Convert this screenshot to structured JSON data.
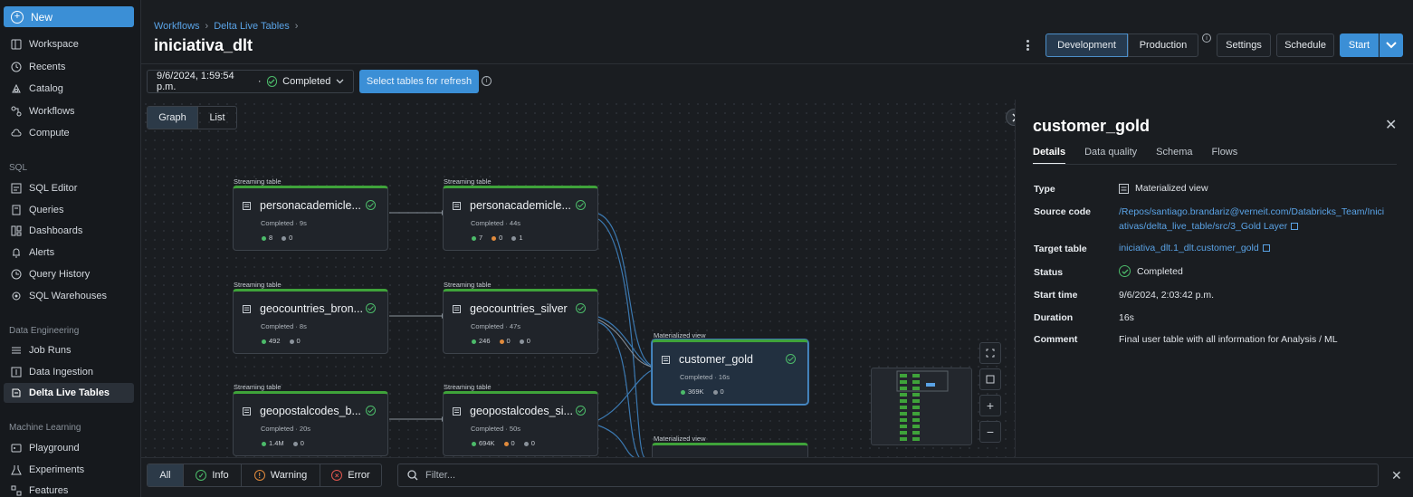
{
  "sidebar": {
    "new_label": "New",
    "items": [
      {
        "label": "Workspace",
        "icon": "workspace-icon"
      },
      {
        "label": "Recents",
        "icon": "clock-icon"
      },
      {
        "label": "Catalog",
        "icon": "catalog-icon"
      },
      {
        "label": "Workflows",
        "icon": "workflows-icon"
      },
      {
        "label": "Compute",
        "icon": "cloud-icon"
      }
    ],
    "sql_section": "SQL",
    "sql_items": [
      {
        "label": "SQL Editor",
        "icon": "sql-editor-icon"
      },
      {
        "label": "Queries",
        "icon": "queries-icon"
      },
      {
        "label": "Dashboards",
        "icon": "dashboards-icon"
      },
      {
        "label": "Alerts",
        "icon": "bell-icon"
      },
      {
        "label": "Query History",
        "icon": "history-icon"
      },
      {
        "label": "SQL Warehouses",
        "icon": "warehouse-icon"
      }
    ],
    "de_section": "Data Engineering",
    "de_items": [
      {
        "label": "Job Runs",
        "icon": "job-runs-icon"
      },
      {
        "label": "Data Ingestion",
        "icon": "ingestion-icon"
      },
      {
        "label": "Delta Live Tables",
        "icon": "dlt-icon",
        "active": true
      }
    ],
    "ml_section": "Machine Learning",
    "ml_items": [
      {
        "label": "Playground",
        "icon": "playground-icon"
      },
      {
        "label": "Experiments",
        "icon": "experiments-icon"
      },
      {
        "label": "Features",
        "icon": "features-icon"
      }
    ]
  },
  "header": {
    "breadcrumb": [
      "Workflows",
      "Delta Live Tables"
    ],
    "title": "iniciativa_dlt",
    "mode_dev": "Development",
    "mode_prod": "Production",
    "settings": "Settings",
    "schedule": "Schedule",
    "start": "Start"
  },
  "toolbar": {
    "run_time": "9/6/2024, 1:59:54 p.m.",
    "run_sep": "·",
    "run_status": "Completed",
    "refresh_button": "Select tables for refresh"
  },
  "graph": {
    "view_tabs": [
      "Graph",
      "List"
    ],
    "nodes": [
      {
        "type": "Streaming table",
        "name": "personacademicle...",
        "status": "Completed · 9s",
        "stats": [
          {
            "c": "g",
            "v": "8"
          },
          {
            "c": "s",
            "v": "0"
          }
        ]
      },
      {
        "type": "Streaming table",
        "name": "personacademicle...",
        "status": "Completed · 44s",
        "stats": [
          {
            "c": "g",
            "v": "7"
          },
          {
            "c": "o",
            "v": "0"
          },
          {
            "c": "s",
            "v": "1"
          }
        ]
      },
      {
        "type": "Streaming table",
        "name": "geocountries_bron...",
        "status": "Completed · 8s",
        "stats": [
          {
            "c": "g",
            "v": "492"
          },
          {
            "c": "s",
            "v": "0"
          }
        ]
      },
      {
        "type": "Streaming table",
        "name": "geocountries_silver",
        "status": "Completed · 47s",
        "stats": [
          {
            "c": "g",
            "v": "246"
          },
          {
            "c": "o",
            "v": "0"
          },
          {
            "c": "s",
            "v": "0"
          }
        ]
      },
      {
        "type": "Streaming table",
        "name": "geopostalcodes_b...",
        "status": "Completed · 20s",
        "stats": [
          {
            "c": "g",
            "v": "1.4M"
          },
          {
            "c": "s",
            "v": "0"
          }
        ]
      },
      {
        "type": "Streaming table",
        "name": "geopostalcodes_si...",
        "status": "Completed · 50s",
        "stats": [
          {
            "c": "g",
            "v": "694K"
          },
          {
            "c": "o",
            "v": "0"
          },
          {
            "c": "s",
            "v": "0"
          }
        ]
      },
      {
        "type": "Materialized view",
        "name": "customer_gold",
        "status": "Completed · 16s",
        "stats": [
          {
            "c": "g",
            "v": "369K"
          },
          {
            "c": "s",
            "v": "0"
          }
        ]
      },
      {
        "type": "Materialized view",
        "name": "",
        "status": "",
        "stats": []
      }
    ],
    "zoom_controls": [
      "fit-view-icon",
      "fullscreen-icon",
      "zoom-in-icon",
      "zoom-out-icon"
    ]
  },
  "panel": {
    "title": "customer_gold",
    "tabs": [
      "Details",
      "Data quality",
      "Schema",
      "Flows"
    ],
    "rows": [
      {
        "label": "Type",
        "value": "Materialized view"
      },
      {
        "label": "Source code",
        "value": "/Repos/santiago.brandariz@verneit.com/Databricks_Team/Iniciativas/delta_live_table/src/3_Gold Layer"
      },
      {
        "label": "Target table",
        "value": "iniciativa_dlt.1_dlt.customer_gold"
      },
      {
        "label": "Status",
        "value": "Completed"
      },
      {
        "label": "Start time",
        "value": "9/6/2024, 2:03:42 p.m."
      },
      {
        "label": "Duration",
        "value": "16s"
      },
      {
        "label": "Comment",
        "value": "Final user table with all information for Analysis / ML"
      }
    ]
  },
  "log": {
    "filters": [
      "All",
      "Info",
      "Warning",
      "Error"
    ],
    "search_placeholder": "Filter..."
  },
  "colors": {
    "accent": "#3b8fd6",
    "success": "#4cbb6a",
    "warning": "#e08a3c",
    "error": "#e0564f"
  }
}
